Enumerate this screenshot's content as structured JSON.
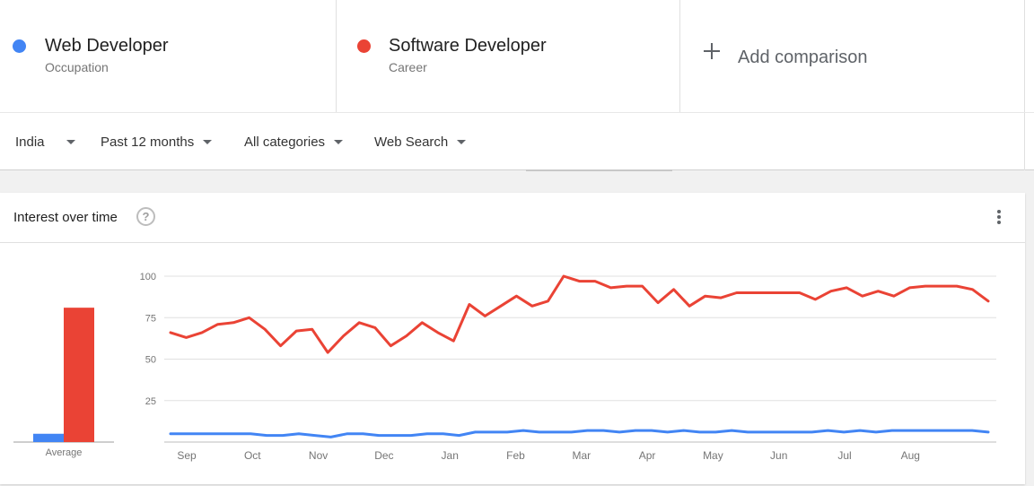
{
  "comparison": {
    "terms": [
      {
        "name": "Web Developer",
        "type": "Occupation",
        "color": "#4285f4"
      },
      {
        "name": "Software Developer",
        "type": "Career",
        "color": "#ea4335"
      }
    ],
    "add_label": "Add comparison"
  },
  "filters": {
    "region": "India",
    "time": "Past 12 months",
    "category": "All categories",
    "search_type": "Web Search"
  },
  "card": {
    "title": "Interest over time",
    "help_icon": "help-circle-icon",
    "menu_icon": "more-vert-icon"
  },
  "chart_data": [
    {
      "type": "bar",
      "categories": [
        "Average"
      ],
      "series": [
        {
          "name": "Web Developer",
          "values": [
            5
          ],
          "color": "#4285f4"
        },
        {
          "name": "Software Developer",
          "values": [
            81
          ],
          "color": "#ea4335"
        }
      ],
      "ylim": [
        0,
        100
      ]
    },
    {
      "type": "line",
      "yticks": [
        25,
        50,
        75,
        100
      ],
      "ylim": [
        0,
        100
      ],
      "month_labels": [
        "Sep",
        "Oct",
        "Nov",
        "Dec",
        "Jan",
        "Feb",
        "Mar",
        "Apr",
        "May",
        "Jun",
        "Jul",
        "Aug"
      ],
      "series": [
        {
          "name": "Web Developer",
          "color": "#4285f4",
          "values": [
            5,
            5,
            5,
            5,
            5,
            5,
            4,
            4,
            5,
            4,
            3,
            5,
            5,
            4,
            4,
            4,
            5,
            5,
            4,
            6,
            6,
            6,
            7,
            6,
            6,
            6,
            7,
            7,
            6,
            7,
            7,
            6,
            7,
            6,
            6,
            7,
            6,
            6,
            6,
            6,
            6,
            7,
            6,
            7,
            6,
            7,
            7,
            7,
            7,
            7,
            7,
            6
          ]
        },
        {
          "name": "Software Developer",
          "color": "#ea4335",
          "values": [
            66,
            63,
            66,
            71,
            72,
            75,
            68,
            58,
            67,
            68,
            54,
            64,
            72,
            69,
            58,
            64,
            72,
            66,
            61,
            83,
            76,
            82,
            88,
            82,
            85,
            100,
            97,
            97,
            93,
            94,
            94,
            84,
            92,
            82,
            88,
            87,
            90,
            90,
            90,
            90,
            90,
            86,
            91,
            93,
            88,
            91,
            88,
            93,
            94,
            94,
            94,
            92,
            85
          ]
        }
      ]
    }
  ]
}
